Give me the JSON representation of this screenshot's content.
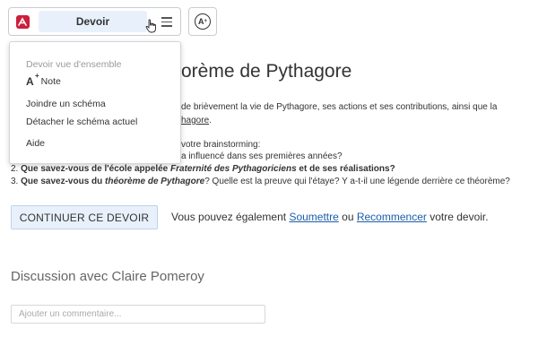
{
  "toolbar": {
    "title": "Devoir",
    "logo_color": "#cc1f3b",
    "logo_icon": "brand-logo-icon",
    "menu_icon": "hamburger-icon",
    "accessibility_label": "A",
    "accessibility_superscript": "+"
  },
  "menu": {
    "overview": "Devoir vue d'ensemble",
    "note_icon": "A",
    "note_icon_superscript": "+",
    "note": "Note",
    "join_schema": "Joindre un schéma",
    "detach_schema": "Détacher le schéma actuel",
    "help": "Aide"
  },
  "content": {
    "title_visible": "orème de Pythagore",
    "intro_line1": "de brièvement la vie de Pythagore, ses actions et ses contributions, ainsi que la",
    "intro_line2": "hagore",
    "intro_line2_suffix": ".",
    "q1_line1": "votre brainstorming:",
    "q1_line2": "a influencé dans ses premières années?",
    "q2_number": "2.",
    "q2_bold1": "Que savez-vous de l'école appelée",
    "q2_italic": "Fraternité des Pythagoriciens",
    "q2_bold2": "et de ses réalisations?",
    "q3_number": "3.",
    "q3_bold": "Que savez-vous du",
    "q3_italic": "théorème de Pythagore",
    "q3_rest": "? Quelle est la preuve qui l'étaye? Y a-t-il une légende derrière ce théorème?",
    "continue_button": "CONTINUER CE DEVOIR",
    "also_prefix": "Vous pouvez également",
    "submit_link": "Soumettre",
    "or_text": "ou",
    "restart_link": "Recommencer",
    "also_suffix": "votre devoir."
  },
  "discussion": {
    "title": "Discussion avec Claire Pomeroy",
    "comment_placeholder": "Ajouter un commentaire..."
  },
  "colors": {
    "accent_bg": "#e8f1fb",
    "link": "#1a5ea8"
  }
}
